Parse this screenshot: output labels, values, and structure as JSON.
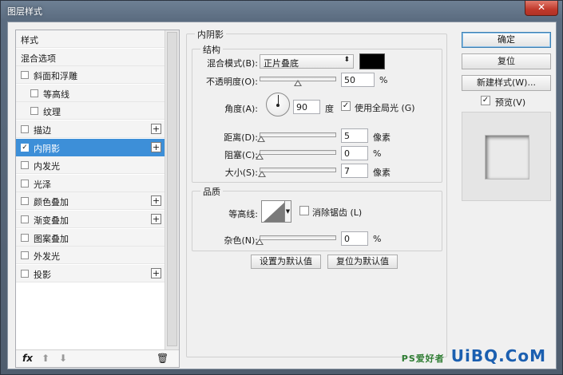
{
  "window": {
    "title": "图层样式",
    "close_label": "✕"
  },
  "list": {
    "items": [
      {
        "label": "样式",
        "checkbox": false,
        "checked": false,
        "plus": false,
        "indent": 0,
        "selected": false
      },
      {
        "label": "混合选项",
        "checkbox": false,
        "checked": false,
        "plus": false,
        "indent": 0,
        "selected": false
      },
      {
        "label": "斜面和浮雕",
        "checkbox": true,
        "checked": false,
        "plus": false,
        "indent": 0,
        "selected": false
      },
      {
        "label": "等高线",
        "checkbox": true,
        "checked": false,
        "plus": false,
        "indent": 1,
        "selected": false
      },
      {
        "label": "纹理",
        "checkbox": true,
        "checked": false,
        "plus": false,
        "indent": 1,
        "selected": false
      },
      {
        "label": "描边",
        "checkbox": true,
        "checked": false,
        "plus": true,
        "indent": 0,
        "selected": false
      },
      {
        "label": "内阴影",
        "checkbox": true,
        "checked": true,
        "plus": true,
        "indent": 0,
        "selected": true
      },
      {
        "label": "内发光",
        "checkbox": true,
        "checked": false,
        "plus": false,
        "indent": 0,
        "selected": false
      },
      {
        "label": "光泽",
        "checkbox": true,
        "checked": false,
        "plus": false,
        "indent": 0,
        "selected": false
      },
      {
        "label": "颜色叠加",
        "checkbox": true,
        "checked": false,
        "plus": true,
        "indent": 0,
        "selected": false
      },
      {
        "label": "渐变叠加",
        "checkbox": true,
        "checked": false,
        "plus": true,
        "indent": 0,
        "selected": false
      },
      {
        "label": "图案叠加",
        "checkbox": true,
        "checked": false,
        "plus": false,
        "indent": 0,
        "selected": false
      },
      {
        "label": "外发光",
        "checkbox": true,
        "checked": false,
        "plus": false,
        "indent": 0,
        "selected": false
      },
      {
        "label": "投影",
        "checkbox": true,
        "checked": false,
        "plus": true,
        "indent": 0,
        "selected": false
      }
    ],
    "footer": {
      "fx": "fx",
      "up": "⬆",
      "down": "⬇",
      "trash": "🗑"
    }
  },
  "inner_shadow": {
    "title": "内阴影",
    "structure": {
      "title": "结构",
      "blend_mode_label": "混合模式(B):",
      "blend_mode_value": "正片叠底",
      "opacity_label": "不透明度(O):",
      "opacity_value": "50",
      "opacity_unit": "%",
      "opacity_level": 0.5,
      "angle_label": "角度(A):",
      "angle_value": "90",
      "angle_unit": "度",
      "global_light_label": "使用全局光 (G)",
      "global_light_checked": true,
      "distance_label": "距离(D):",
      "distance_value": "5",
      "distance_unit": "像素",
      "distance_level": 0.02,
      "choke_label": "阻塞(C):",
      "choke_value": "0",
      "choke_unit": "%",
      "choke_level": 0.0,
      "size_label": "大小(S):",
      "size_value": "7",
      "size_unit": "像素",
      "size_level": 0.03
    },
    "quality": {
      "title": "品质",
      "contour_label": "等高线:",
      "antialias_label": "消除锯齿 (L)",
      "noise_label": "杂色(N):",
      "noise_value": "0",
      "noise_unit": "%",
      "noise_level": 0.0
    },
    "make_default": "设置为默认值",
    "reset_default": "复位为默认值"
  },
  "buttons": {
    "ok": "确定",
    "reset": "复位",
    "new_style": "新建样式(W)...",
    "preview_label": "预览(V)",
    "preview_checked": true
  },
  "watermark": {
    "text": "UiBQ.CoM",
    "small": "PS爱好者"
  }
}
